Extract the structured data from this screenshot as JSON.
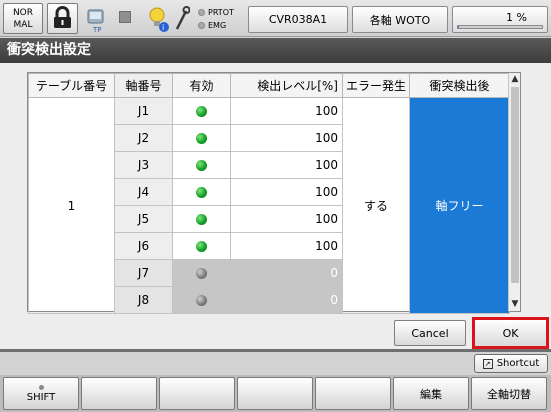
{
  "status": {
    "mode_line1": "NOR",
    "mode_line2": "MAL",
    "tp_label": "TP",
    "prtot_label": "PRTOT",
    "emg_label": "EMG",
    "program": "CVR038A1",
    "axes": "各軸 WOTO",
    "speed_text": "1 %",
    "speed_fraction": 0.01,
    "icons": [
      "lock-icon",
      "tp-icon",
      "square-icon",
      "bulb-icon",
      "wrench-icon"
    ]
  },
  "title": "衝突検出設定",
  "table": {
    "headers": [
      "テーブル番号",
      "軸番号",
      "有効",
      "検出レベル[%]",
      "エラー発生",
      "衝突検出後"
    ],
    "table_number": "1",
    "error_occur": "する",
    "after_detection": "軸フリー",
    "rows": [
      {
        "axis": "J1",
        "enabled": true,
        "level": "100"
      },
      {
        "axis": "J2",
        "enabled": true,
        "level": "100"
      },
      {
        "axis": "J3",
        "enabled": true,
        "level": "100"
      },
      {
        "axis": "J4",
        "enabled": true,
        "level": "100"
      },
      {
        "axis": "J5",
        "enabled": true,
        "level": "100"
      },
      {
        "axis": "J6",
        "enabled": true,
        "level": "100"
      },
      {
        "axis": "J7",
        "enabled": false,
        "level": "0"
      },
      {
        "axis": "J8",
        "enabled": false,
        "level": "0"
      }
    ]
  },
  "buttons": {
    "cancel": "Cancel",
    "ok": "OK",
    "shortcut": "Shortcut"
  },
  "fkeys": [
    "SHIFT",
    "",
    "",
    "",
    "",
    "編集",
    "全軸切替"
  ],
  "colors": {
    "accent_blue": "#1a7ad6",
    "ok_highlight": "#d9141a",
    "led_on": "#0f9a22"
  }
}
